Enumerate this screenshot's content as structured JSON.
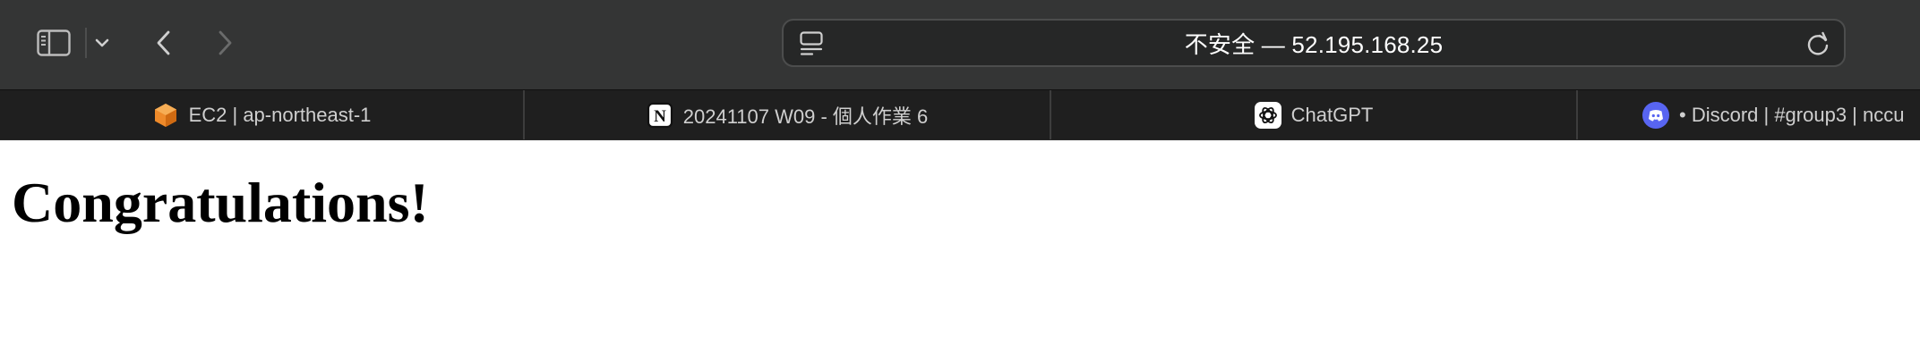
{
  "toolbar": {
    "address_text": "不安全 — 52.195.168.25"
  },
  "tabs": [
    {
      "title": "EC2 | ap-northeast-1",
      "icon": "aws-ec2-icon"
    },
    {
      "title": "20241107 W09 - 個人作業 6",
      "icon": "notion-icon"
    },
    {
      "title": "ChatGPT",
      "icon": "chatgpt-icon"
    },
    {
      "title": "• Discord | #group3 | nccu",
      "icon": "discord-icon"
    }
  ],
  "page": {
    "heading": "Congratulations!"
  },
  "colors": {
    "toolbar_bg": "#343535",
    "tabstrip_bg": "#1f1f1f",
    "discord_brand": "#5865f2",
    "aws_orange": "#ee8a2a"
  }
}
